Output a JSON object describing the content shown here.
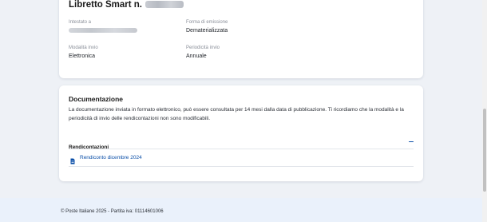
{
  "libretto": {
    "title": "Libretto Smart n.",
    "fields": [
      {
        "label": "Intestato a",
        "value": ""
      },
      {
        "label": "Forma di emissione",
        "value": "Dematerializzata"
      },
      {
        "label": "Modalità invio",
        "value": "Elettronica"
      },
      {
        "label": "Periodicità invio",
        "value": "Annuale"
      }
    ]
  },
  "documentazione": {
    "title": "Documentazione",
    "description": "La documentazione inviata in formato elettronico, può essere consultata per 14 mesi dalla data di pubblicazione. Ti ricordiamo che la modalità e la periodicità di invio delle rendicontazioni non sono modificabili.",
    "accordion": {
      "title": "Rendicontazioni",
      "toggle_icon": "minus-icon",
      "items": [
        {
          "label": "Rendiconto dicembre 2024",
          "icon": "document-icon"
        }
      ]
    }
  },
  "footer": {
    "text": "© Poste Italiane 2025 - Partita iva: 01114601006"
  },
  "colors": {
    "accent": "#0b4fa8",
    "page_background": "#eef1f6",
    "footer_background": "#eaf1fb"
  }
}
